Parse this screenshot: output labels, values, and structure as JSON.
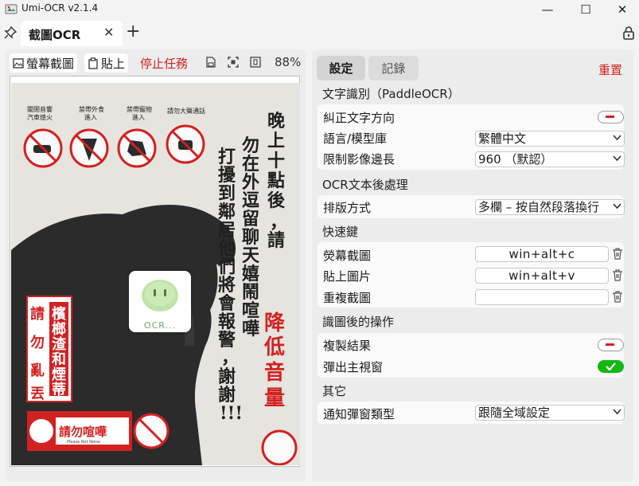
{
  "window": {
    "title": "Umi-OCR v2.1.4",
    "controls": {
      "minimize": "—",
      "maximize": "☐",
      "close": "✕"
    }
  },
  "tabs": {
    "active_label": "截圖OCR",
    "close_glyph": "✕",
    "add_glyph": "+"
  },
  "left_toolbar": {
    "screenshot_label": "螢幕截圖",
    "paste_label": "貼上",
    "stop_label": "停止任務",
    "zoom": "88%"
  },
  "poster": {
    "title": "晚上十點後，請",
    "title_red": "降低音量",
    "body_col1": "勿在外逗留聊天嬉鬧喧嘩",
    "body_col2": "打擾到鄰居他們將會報警，謝謝!!!",
    "red_sign_col1": "檳榔渣和煙蒂",
    "red_sign_col2": "請勿亂丟",
    "bottom_sign": "請勿喧嘩",
    "bottom_sign_sub": "Please Not Noise",
    "icon_labels": [
      "關閉音響\n汽車熄火",
      "禁帶外食\n進入",
      "禁帶寵物\n進入",
      "請勿大聲通話"
    ],
    "sticker": "OCR..."
  },
  "right_tabs": {
    "settings": "設定",
    "records": "記錄",
    "reset": "重置"
  },
  "sections": {
    "ocr": {
      "title": "文字識別（PaddleOCR）",
      "correct_direction": "糾正文字方向",
      "language_label": "語言/模型庫",
      "language_value": "繁體中文",
      "limit_label": "限制影像邊長",
      "limit_value": "960 （默認）"
    },
    "post": {
      "title": "OCR文本後處理",
      "layout_label": "排版方式",
      "layout_value": "多欄 – 按自然段落換行"
    },
    "hotkeys": {
      "title": "快速鍵",
      "screenshot_label": "熒幕截圖",
      "screenshot_value": "win+alt+c",
      "paste_label": "貼上圖片",
      "paste_value": "win+alt+v",
      "repeat_label": "重複截圖",
      "repeat_value": ""
    },
    "after": {
      "title": "識圖後的操作",
      "copy_label": "複製結果",
      "popup_label": "彈出主視窗"
    },
    "other": {
      "title": "其它",
      "notify_label": "通知彈窗類型",
      "notify_value": "跟隨全域設定"
    }
  },
  "colors": {
    "accent_red": "#d22121",
    "toggle_on": "#14b814"
  },
  "toggles": {
    "correct_direction": false,
    "copy_result": false,
    "popup_window": true
  }
}
